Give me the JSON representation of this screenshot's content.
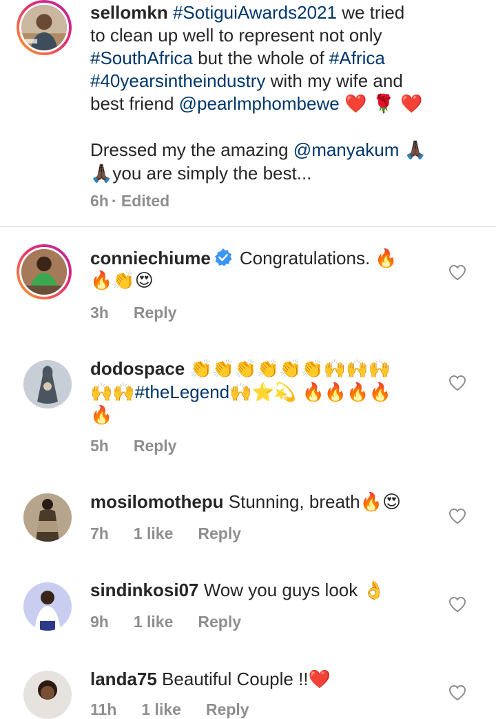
{
  "post": {
    "username": "sellomkn",
    "caption_line1": "#SotiguiAwards2021",
    "caption_line1_rest": " we tried",
    "caption_line2": "to clean up well to represent not only",
    "caption_line3_tag": "#SouthAfrica",
    "caption_line3_rest": " but the whole of ",
    "caption_line3_tag2": "#Africa",
    "caption_line4_tag": "#40yearsintheindustry",
    "caption_line4_rest": " with my wife and",
    "caption_line5": "best friend ",
    "caption_line5_tag": "@pearlmphombewe",
    "caption_line5_emoji": "❤️ 🌹 ❤️",
    "caption_line6": "Dressed my the amazing ",
    "caption_line6_tag": "@manyakum",
    "caption_line6_emoji": "🙏🏿",
    "caption_line7_emoji": "🙏🏿",
    "caption_line7": "you are simply the best...",
    "time": "6h",
    "edited": "· Edited"
  },
  "comments": [
    {
      "username": "conniechiume",
      "verified": true,
      "text_line1": "Congratulations. 🔥",
      "text_line2": "🔥👏😍",
      "time": "3h",
      "likes": "",
      "reply": "Reply"
    },
    {
      "username": "dodospace",
      "text_line1": "👏👏👏👏👏👏🙌🙌🙌",
      "text_line2_pre": "🙌🙌",
      "text_line2_tag": "#theLegend",
      "text_line2_post": "🙌⭐💫 🔥🔥🔥🔥",
      "text_line3": "🔥",
      "time": "5h",
      "likes": "",
      "reply": "Reply"
    },
    {
      "username": "mosilomothepu",
      "text_line1": " Stunning, breath🔥😍",
      "time": "7h",
      "likes": "1 like",
      "reply": "Reply"
    },
    {
      "username": "sindinkosi07",
      "text_line1": " Wow you guys look 👌",
      "time": "9h",
      "likes": "1 like",
      "reply": "Reply"
    },
    {
      "username": "landa75",
      "text_line1": " Beautiful Couple !!❤️",
      "time": "11h",
      "likes": "1 like",
      "reply": "Reply"
    }
  ],
  "icons": {
    "like": "heart-outline-icon",
    "verified": "verified-badge-icon"
  },
  "colors": {
    "hashtag": "#00376b",
    "meta": "#8e8e8e",
    "heart_outline": "#8e8e8e",
    "verified": "#3897f0",
    "ring_start": "#f9a62c",
    "ring_end": "#b323a4"
  }
}
